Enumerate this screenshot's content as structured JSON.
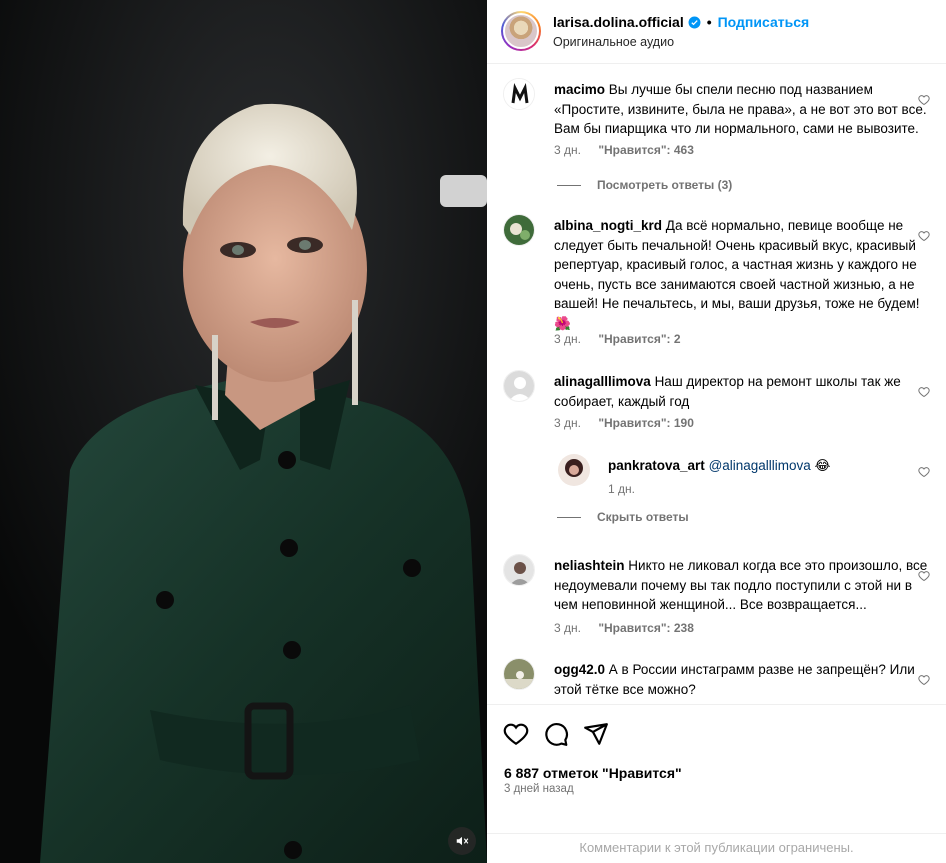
{
  "header": {
    "username": "larisa.dolina.official",
    "separator": "•",
    "follow_label": "Подписаться",
    "subtitle": "Оригинальное аудио"
  },
  "comments": [
    {
      "username": "macimo",
      "text": "Вы лучше бы спели песню под названием «Простите, извините, была не права», а не вот это вот все. Вам бы пиарщика что ли нормального, сами не вывозите.",
      "time": "3 дн.",
      "likes": "\"Нравится\": 463",
      "view_replies": "Посмотреть ответы (3)"
    },
    {
      "username": "albina_nogti_krd",
      "text": "Да всё нормально, певице вообще не следует быть печальной! Очень красивый вкус, красивый репертуар, красивый голос, а частная жизнь у каждого не очень, пусть все занимаются своей частной жизнью, а не вашей! Не печальтесь, и мы, ваши друзья, тоже не будем!",
      "emoji": "🌺",
      "time": "3 дн.",
      "likes": "\"Нравится\": 2"
    },
    {
      "username": "alinagalllimova",
      "text": "Наш директор на ремонт школы так же собирает, каждый год",
      "time": "3 дн.",
      "likes": "\"Нравится\": 190",
      "reply": {
        "username": "pankratova_art",
        "mention": "@alinagalllimova",
        "emoji": "😂",
        "time": "1 дн."
      },
      "hide_replies": "Скрыть ответы"
    },
    {
      "username": "neliashtein",
      "text": "Никто не ликовал когда все это произошло, все недоумевали почему вы так подло поступили с этой ни в чем неповинной женщиной... Все возвращается...",
      "time": "3 дн.",
      "likes": "\"Нравится\": 238"
    },
    {
      "username": "ogg42.0",
      "text": "А в России инстаграмм разве не запрещён? Или этой тётке все можно?"
    }
  ],
  "footer": {
    "likes_count": "6 887 отметок \"Нравится\"",
    "post_time": "3 дней назад",
    "restricted_note": "Комментарии к этой публикации ограничены."
  },
  "icons": {
    "like": "heart-outline-icon",
    "comment": "comment-bubble-icon",
    "share": "paper-plane-icon",
    "mute": "speaker-muted-icon",
    "verified": "verified-badge-icon"
  },
  "colors": {
    "accent_blue": "#0095f6",
    "verified_blue": "#0095f6",
    "secondary_text": "#737373",
    "mention": "#00376b",
    "media_bg": "#0b0c0d",
    "jacket_green": "#1d3a30"
  }
}
